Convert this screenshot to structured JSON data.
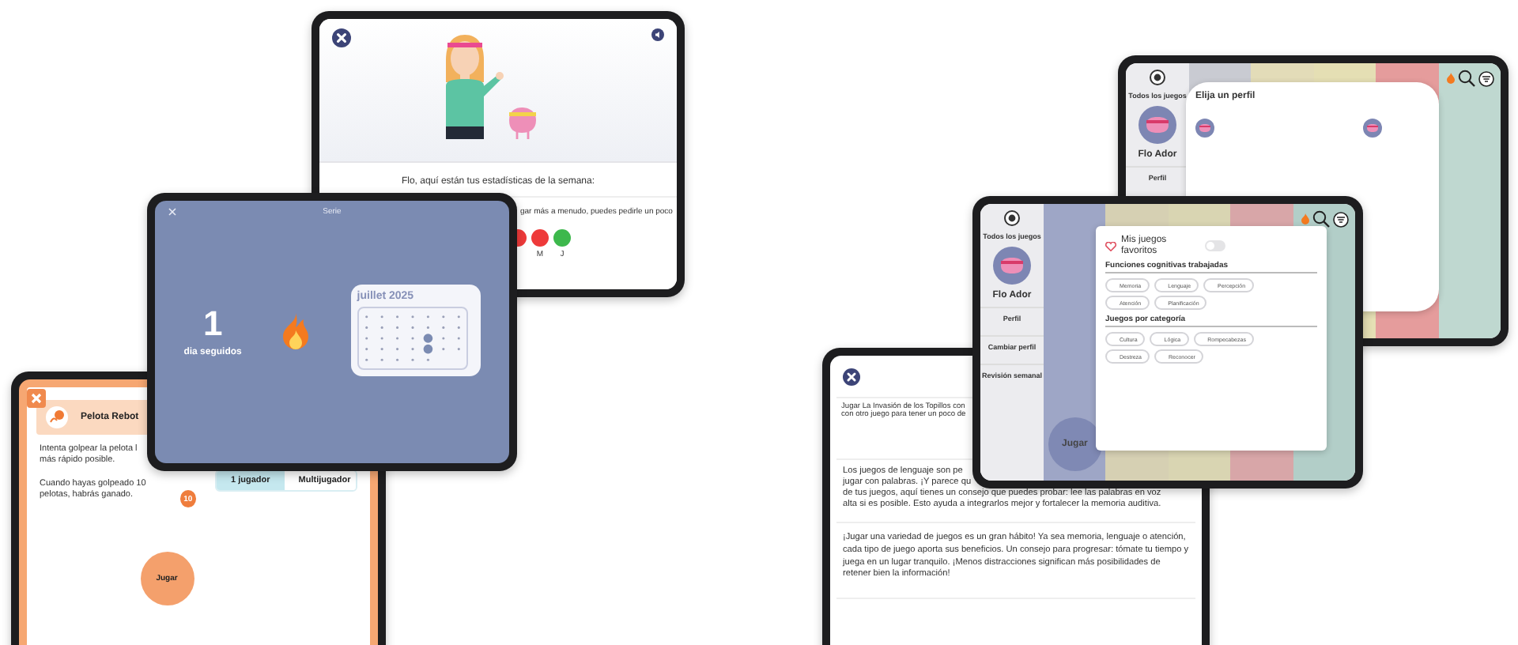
{
  "stats_tablet": {
    "message": "Flo, aquí están tus estadísticas de la semana:",
    "tip_fragment": "gar más a menudo, puedes pedirle un poco",
    "days": [
      {
        "color": "#ee3a3a"
      },
      {
        "label": "M",
        "color": "#ee3a3a"
      },
      {
        "label": "J",
        "color": "#3db84c"
      }
    ]
  },
  "streak_tablet": {
    "title": "Serie",
    "count": "1",
    "caption": "dia seguidos",
    "calendar_month": "juillet 2025"
  },
  "game_tablet": {
    "title": "Pelota Rebot",
    "instructions": [
      "Intenta golpear la pelota l",
      "más rápido posible."
    ],
    "goal": "Cuando hayas golpeado 10 pelotas, habrás ganado.",
    "target_badge": "10",
    "modes": [
      {
        "label": "1 jugador",
        "selected": true
      },
      {
        "label": "Multijugador",
        "selected": false
      }
    ],
    "play_button": "Jugar"
  },
  "tips_tablet": {
    "intro_lines": [
      "Jugar La Invasión de los Topillos con",
      "con otro juego para tener un poco de"
    ],
    "tip_lines": [
      "Los juegos de lenguaje son pe",
      "jugar con palabras. ¡Y parece qu",
      "de tus juegos, aquí tienes un consejo que puedes probar: lee las palabras en voz",
      "alta si es posible. Esto ayuda a integrarlos mejor y fortalecer la memoria auditiva."
    ],
    "tip_2": "¡Jugar una variedad de juegos es un gran hábito! Ya sea memoria, lenguaje o atención, cada tipo de juego aporta sus beneficios. Un consejo para progresar: tómate tu tiempo y juega en un lugar tranquilo. ¡Menos distracciones significan más posibilidades de retener bien la información!"
  },
  "filter_tablet": {
    "sidebar": {
      "all_games": "Todos los juegos",
      "profile_name": "Flo Ador",
      "items": [
        "Perfil",
        "Cambiar perfil",
        "Revisión semanal"
      ]
    },
    "columns": [
      {
        "color": "#9ea6c6"
      },
      {
        "color": "#d6d0b3"
      },
      {
        "color": "#d9d5b2"
      },
      {
        "color": "#d8a6a8"
      },
      {
        "color": "#b2cec8"
      }
    ],
    "play_button": "Jugar",
    "favorites": {
      "label": "Mis juegos favoritos",
      "on": false
    },
    "sections": [
      {
        "title": "Funciones cognitivas trabajadas",
        "chips": [
          "Memoria",
          "Lenguaje",
          "Percepción",
          "Atención",
          "Planificación"
        ]
      },
      {
        "title": "Juegos por categoría",
        "chips": [
          "Cultura",
          "Lógica",
          "Rompecabezas",
          "Destreza",
          "Reconocer"
        ]
      }
    ]
  },
  "profiles_tablet": {
    "sidebar": {
      "all_games": "Todos los juegos",
      "profile_name": "Flo Ador",
      "items": [
        "Perfil"
      ]
    },
    "columns": [
      {
        "color": "#c9cbd2"
      },
      {
        "color": "#e3dcb8"
      },
      {
        "color": "#e5dfb4"
      },
      {
        "color": "#e59c9c"
      },
      {
        "color": "#bfd8d0"
      }
    ],
    "dialog_title": "Elija un perfil"
  }
}
